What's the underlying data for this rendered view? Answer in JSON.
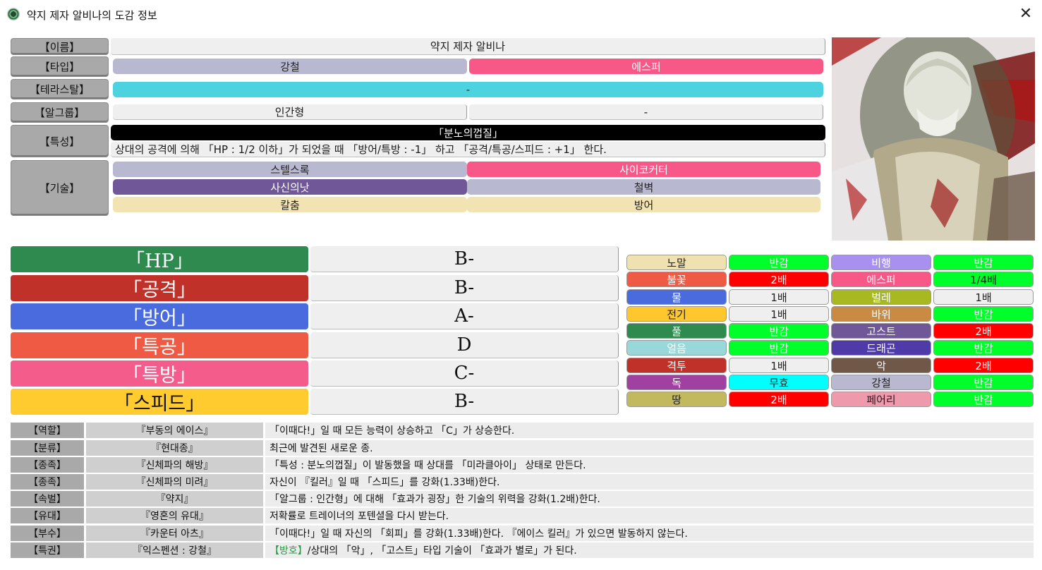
{
  "window": {
    "title": "약지 제자 알비나의 도감 정보",
    "close_glyph": "✕"
  },
  "info": {
    "name_label": "【이름】",
    "name": "약지 제자 알비나",
    "type_label": "【타입】",
    "type1": "강철",
    "type2": "에스퍼",
    "tera_label": "【테라스탈】",
    "tera": "-",
    "egg_label": "【알그룹】",
    "egg1": "인간형",
    "egg2": "-",
    "ability_label": "【특성】",
    "ability_name": "「분노의껍질」",
    "ability_desc": "상대의 공격에 의해 「HP : 1/2 이하」가 되었을 때 「방어/특방 : -1」 하고 「공격/특공/스피드 : +1」 한다.",
    "moves_label": "【기술】",
    "moves": [
      "스텔스록",
      "사이코커터",
      "사신의낫",
      "철벽",
      "칼춤",
      "방어"
    ]
  },
  "stats": [
    {
      "name": "「HP」",
      "grade": "B-"
    },
    {
      "name": "「공격」",
      "grade": "B-"
    },
    {
      "name": "「방어」",
      "grade": "A-"
    },
    {
      "name": "「특공」",
      "grade": "D"
    },
    {
      "name": "「특방」",
      "grade": "C-"
    },
    {
      "name": "「스피드」",
      "grade": "B-"
    }
  ],
  "types": [
    {
      "type": "노말",
      "eff": "반감"
    },
    {
      "type": "비행",
      "eff": "반감"
    },
    {
      "type": "불꽃",
      "eff": "2배"
    },
    {
      "type": "에스퍼",
      "eff": "1/4배"
    },
    {
      "type": "물",
      "eff": "1배"
    },
    {
      "type": "벌레",
      "eff": "1배"
    },
    {
      "type": "전기",
      "eff": "1배"
    },
    {
      "type": "바위",
      "eff": "반감"
    },
    {
      "type": "풀",
      "eff": "반감"
    },
    {
      "type": "고스트",
      "eff": "2배"
    },
    {
      "type": "얼음",
      "eff": "반감"
    },
    {
      "type": "드래곤",
      "eff": "반감"
    },
    {
      "type": "격투",
      "eff": "1배"
    },
    {
      "type": "악",
      "eff": "2배"
    },
    {
      "type": "독",
      "eff": "무효"
    },
    {
      "type": "강철",
      "eff": "반감"
    },
    {
      "type": "땅",
      "eff": "2배"
    },
    {
      "type": "페어리",
      "eff": "반감"
    }
  ],
  "traits": [
    {
      "label": "【역할】",
      "name": "『부동의 에이스』",
      "desc": "「이때다!」일 때 모든 능력이 상승하고 「C」가 상승한다."
    },
    {
      "label": "【분류】",
      "name": "『현대종』",
      "desc": "최근에 발견된 새로운 종."
    },
    {
      "label": "【종족】",
      "name": "『신체파의 해방』",
      "desc": "「특성 : 분노의껍질」이 발동했을 때 상대를 「미라클아이」 상태로 만든다."
    },
    {
      "label": "【종족】",
      "name": "『신체파의 미려』",
      "desc": "자신이 『킬러』일 때 「스피드」를 강화(1.33배)한다."
    },
    {
      "label": "【속벌】",
      "name": "『약지』",
      "desc": "「알그룹 : 인간형」에 대해 「효과가 굉장」한 기술의 위력을 강화(1.2배)한다."
    },
    {
      "label": "【유대】",
      "name": "『영혼의 유대』",
      "desc": "저확률로 트레이너의 포텐셜을 다시 받는다."
    },
    {
      "label": "【부수】",
      "name": "『카운터 아츠』",
      "desc": "「이때다!」일 때 자신의 「회피」를 강화(1.33배)한다. 『에이스 킬러』가 있으면 발동하지 않는다."
    },
    {
      "label": "【특권】",
      "name": "『익스펜션 : 강철』",
      "desc_prefix": "【방호】",
      "desc": "/상대의 「악」, 「고스트」타입 기술이 「효과가 별로」가 된다."
    }
  ],
  "colors": {
    "steel": "#b8b8d0",
    "psychic": "#f85888",
    "tera": "#4dd2e0",
    "ability": "#000000",
    "ghost_move": "#705898",
    "normal_move": "#e8dcaa",
    "stat_hp": "#2e8a4f",
    "stat_atk": "#c0312a",
    "stat_def": "#4a6bde",
    "stat_spa": "#ef5a44",
    "stat_spd": "#f45c8c",
    "stat_spe": "#ffcb2e"
  }
}
